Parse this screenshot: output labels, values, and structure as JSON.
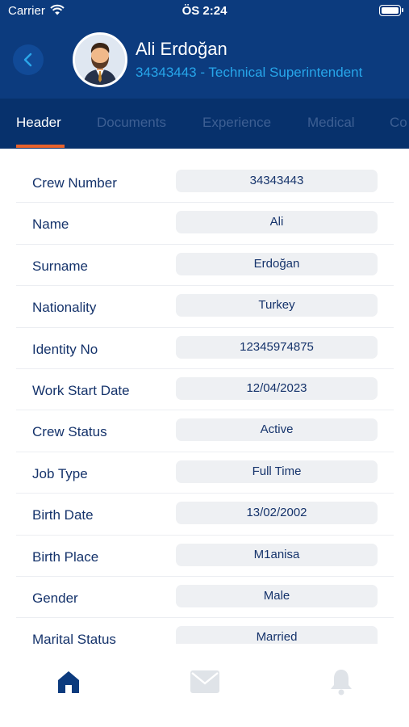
{
  "status_bar": {
    "carrier": "Carrier",
    "time": "ÖS 2:24"
  },
  "profile": {
    "name": "Ali Erdoğan",
    "subtitle": "34343443 - Technical Superintendent"
  },
  "tabs": [
    {
      "label": "Header",
      "active": true
    },
    {
      "label": "Documents",
      "active": false
    },
    {
      "label": "Experience",
      "active": false
    },
    {
      "label": "Medical",
      "active": false
    },
    {
      "label": "Co",
      "active": false
    }
  ],
  "fields": [
    {
      "label": "Crew Number",
      "value": "34343443"
    },
    {
      "label": "Name",
      "value": "Ali"
    },
    {
      "label": "Surname",
      "value": "Erdoğan"
    },
    {
      "label": "Nationality",
      "value": "Turkey"
    },
    {
      "label": "Identity No",
      "value": "12345974875"
    },
    {
      "label": "Work Start Date",
      "value": "12/04/2023"
    },
    {
      "label": "Crew Status",
      "value": "Active"
    },
    {
      "label": "Job Type",
      "value": "Full Time"
    },
    {
      "label": "Birth Date",
      "value": "13/02/2002"
    },
    {
      "label": "Birth Place",
      "value": "M1anisa"
    },
    {
      "label": "Gender",
      "value": "Male"
    },
    {
      "label": "Marital Status",
      "value": "Married"
    }
  ],
  "bottom_nav": [
    {
      "icon": "home-icon",
      "active": true
    },
    {
      "icon": "mail-icon",
      "active": false
    },
    {
      "icon": "bell-icon",
      "active": false
    }
  ],
  "colors": {
    "header_bg": "#0c3b7e",
    "tabbar_bg": "#07316c",
    "accent_orange": "#e8622c",
    "subtitle_blue": "#27a6ea",
    "text_navy": "#15336b"
  }
}
